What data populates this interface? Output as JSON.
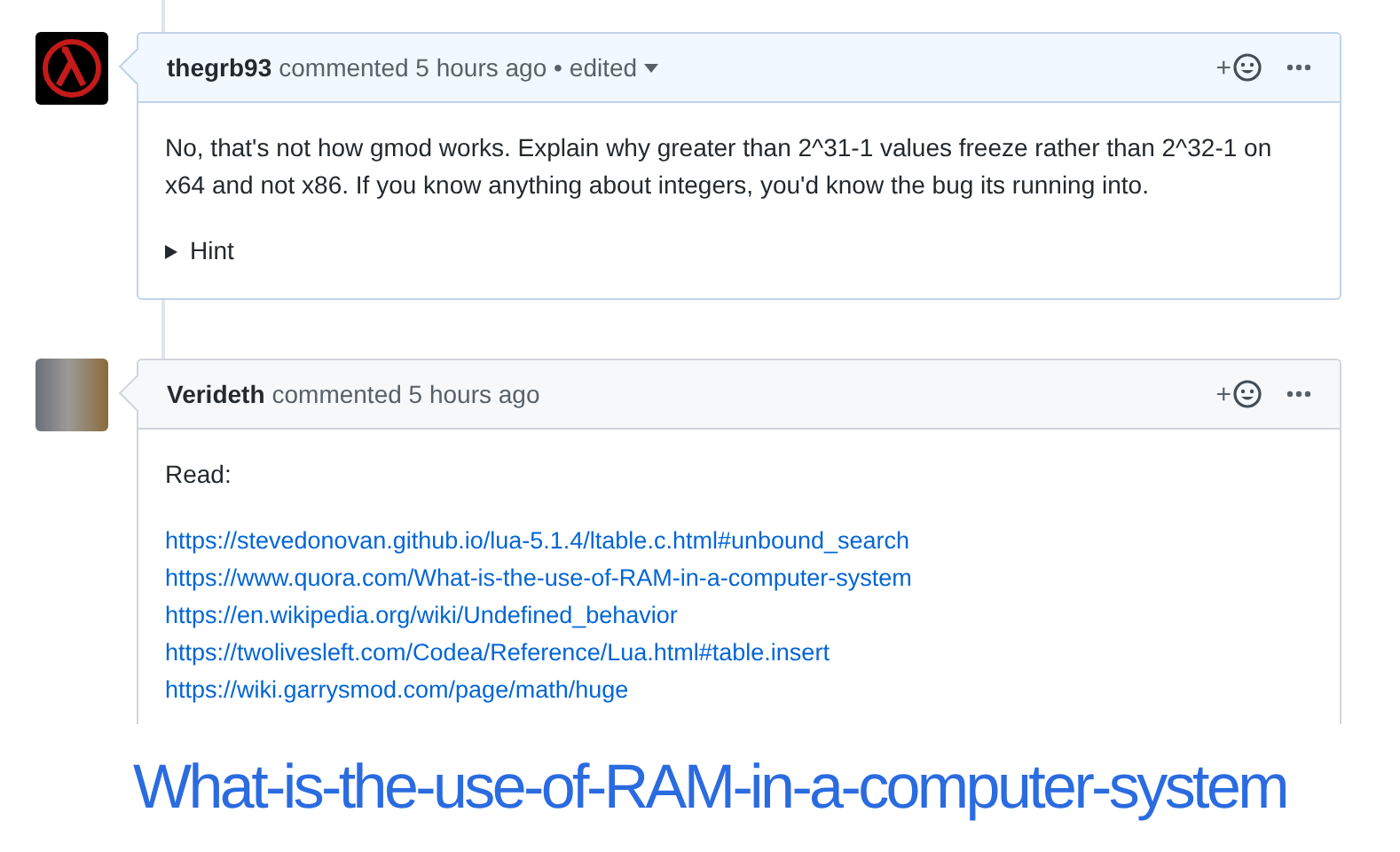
{
  "comments": [
    {
      "author": "thegrb93",
      "action": "commented",
      "time": "5 hours ago",
      "edited": true,
      "separator": "•",
      "edited_label": "edited",
      "highlighted": true,
      "avatar": {
        "kind": "logo"
      },
      "text": "No, that's not how gmod works. Explain why greater than 2^31-1 values freeze rather than 2^32-1 on x64 and not x86. If you know anything about integers, you'd know the bug its running into.",
      "details": {
        "summary": "Hint",
        "expanded": false
      },
      "reaction_label": "+"
    },
    {
      "author": "Verideth",
      "action": "commented",
      "time": "5 hours ago",
      "edited": false,
      "highlighted": false,
      "avatar": {
        "kind": "photo"
      },
      "text": "Read:",
      "reaction_label": "+",
      "links": [
        "https://stevedonovan.github.io/lua-5.1.4/ltable.c.html#unbound_search",
        "https://www.quora.com/What-is-the-use-of-RAM-in-a-computer-system",
        "https://en.wikipedia.org/wiki/Undefined_behavior",
        "https://twolivesleft.com/Codea/Reference/Lua.html#table.insert",
        "https://wiki.garrysmod.com/page/math/huge"
      ]
    }
  ],
  "zoomed_text": "What-is-the-use-of-RAM-in-a-computer-system"
}
